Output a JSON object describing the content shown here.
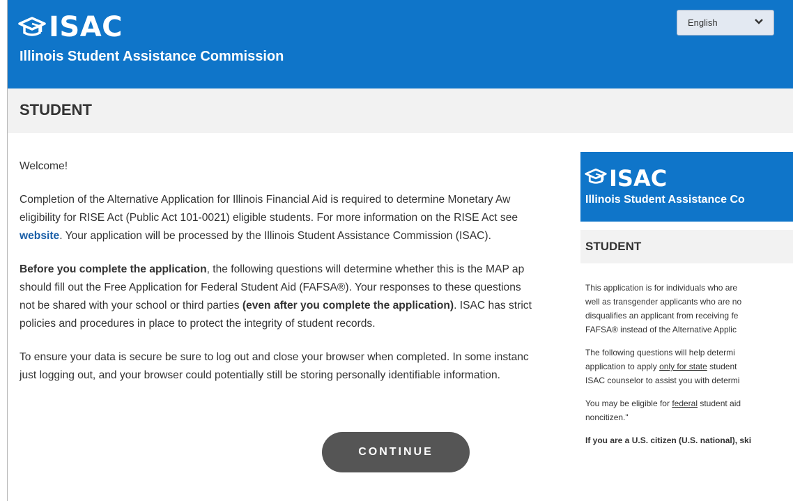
{
  "header": {
    "logo_text": "ISAC",
    "subtitle": "Illinois Student Assistance Commission",
    "language": "English"
  },
  "section": {
    "title": "STUDENT"
  },
  "content": {
    "welcome": "Welcome!",
    "p1_a": "Completion of the Alternative Application for Illinois Financial Aid is required to determine Monetary Aw",
    "p1_b": "eligibility for RISE Act (Public Act 101-0021) eligible students. For more information on the RISE Act see",
    "p1_link": "website",
    "p1_c": ". Your application will be processed by the Illinois Student Assistance Commission (ISAC).",
    "p2_bold": "Before you complete the application",
    "p2_a": ", the following questions will determine whether this is the MAP ap",
    "p2_b": "should fill out the Free Application for Federal Student Aid (FAFSA®). Your responses to these questions",
    "p2_c": "not be shared with your school or third parties ",
    "p2_c_bold": "(even after you complete the application)",
    "p2_d": ". ISAC has strict",
    "p2_e": "policies and procedures in place to protect the integrity of student records.",
    "p3_a": "To ensure your data is secure be sure to log out and close your browser when completed. In some instanc",
    "p3_b": "just logging out, and your browser could potentially still be storing personally identifiable information.",
    "continue_label": "CONTINUE"
  },
  "panel": {
    "logo_text": "ISAC",
    "subtitle": "Illinois Student Assistance Co",
    "title": "STUDENT",
    "l1": "This application is for individuals who are",
    "l2": "well as transgender applicants who are no",
    "l3": "disqualifies an applicant from receiving fe",
    "l4": "FAFSA® instead of the Alternative Applic",
    "l5": "The following questions will help determi",
    "l6_a": "application to apply ",
    "l6_u": "only for state",
    "l6_b": " student",
    "l7": "ISAC counselor to assist you with determi",
    "l8_a": "You may be eligible for ",
    "l8_u": "federal",
    "l8_b": " student aid",
    "l9": "noncitizen.\"",
    "l10": "If you are a U.S. citizen (U.S. national), ski"
  },
  "colors": {
    "brand_blue": "#0f75c9",
    "band_gray": "#f2f2f2",
    "button_gray": "#555555",
    "link_blue": "#1a5fa8"
  },
  "icons": {
    "logo": "graduation-cap-icon",
    "dropdown": "chevron-down-icon"
  }
}
